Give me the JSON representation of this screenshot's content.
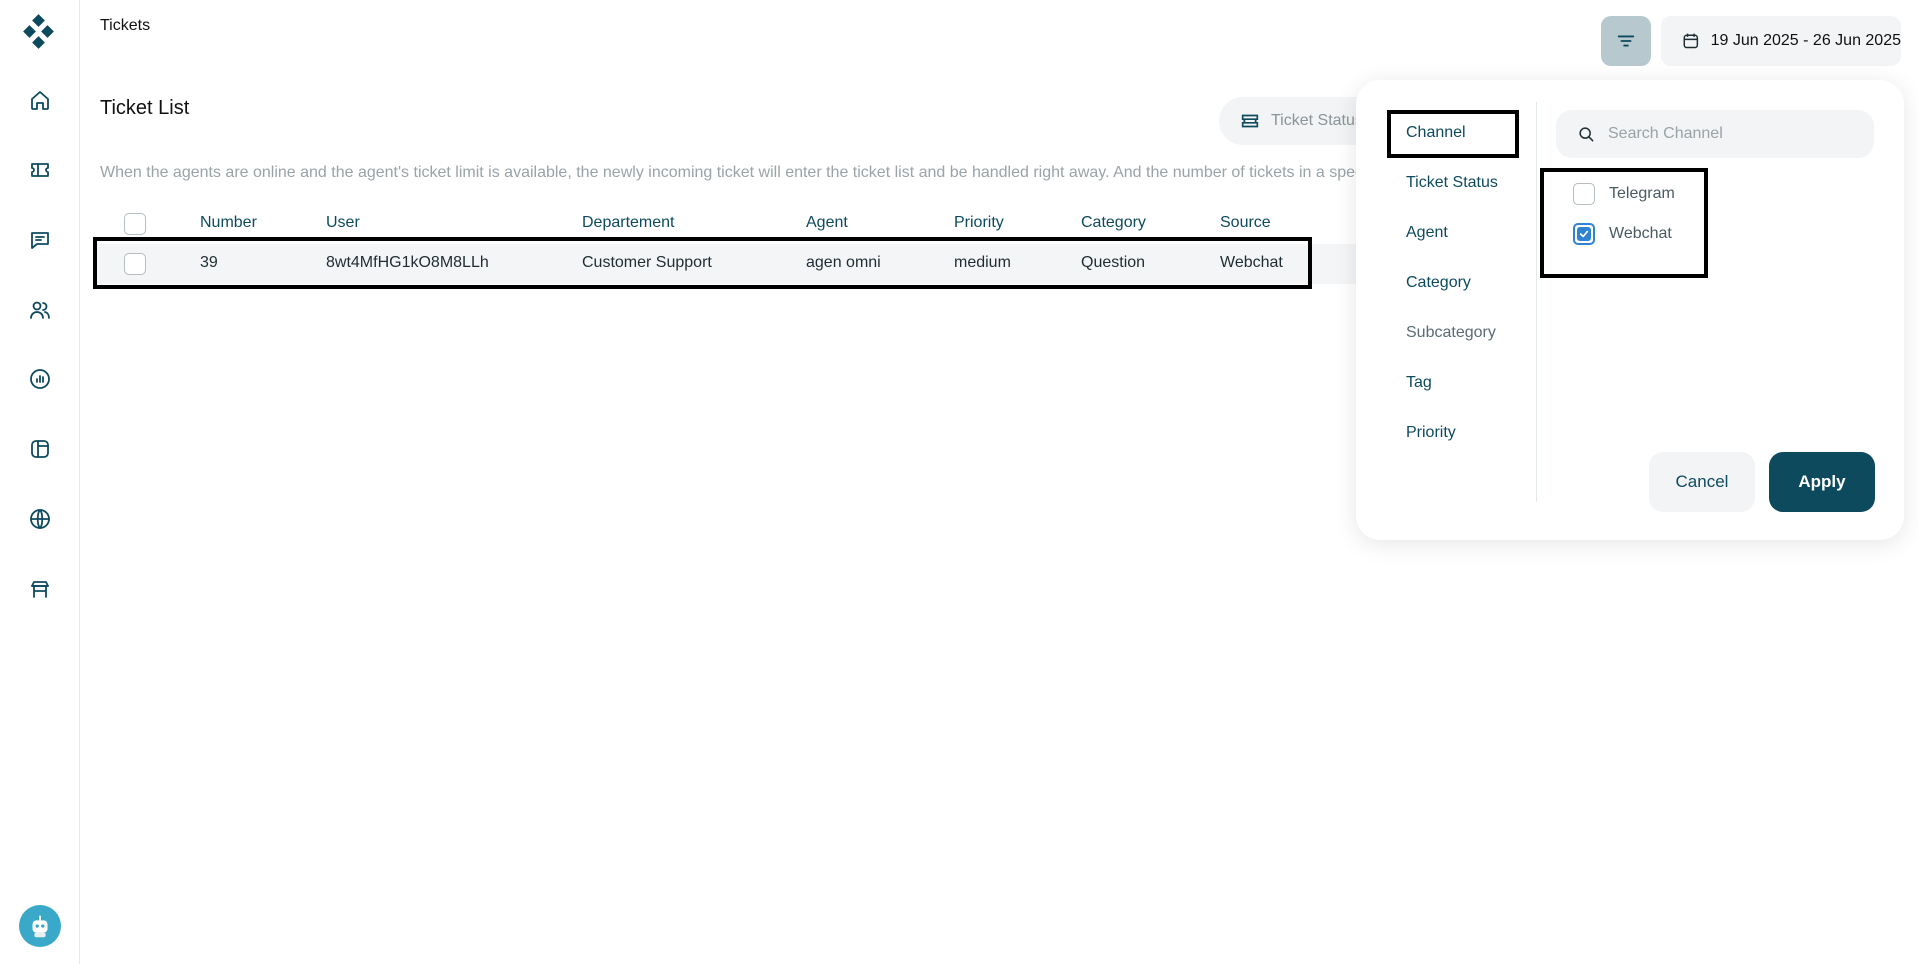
{
  "header": {
    "breadcrumb": "Tickets",
    "date_range": "19 Jun 2025 - 26 Jun 2025"
  },
  "sidebar": {
    "items": [
      {
        "icon": "home-icon"
      },
      {
        "icon": "ticket-icon"
      },
      {
        "icon": "chat-icon"
      },
      {
        "icon": "users-icon"
      },
      {
        "icon": "report-icon"
      },
      {
        "icon": "template-icon"
      },
      {
        "icon": "globe-icon"
      },
      {
        "icon": "store-icon"
      }
    ],
    "avatar_icon": "robot-avatar-icon"
  },
  "main": {
    "title": "Ticket List",
    "ticket_status_button": "Ticket Status",
    "description": "When the agents are online and the agent's ticket limit is available, the newly incoming ticket will enter the ticket list and be handled right away. And the number of tickets in a specific",
    "table": {
      "columns": [
        "Number",
        "User",
        "Departement",
        "Agent",
        "Priority",
        "Category",
        "Source"
      ],
      "rows": [
        [
          "39",
          "8wt4MfHG1kO8M8LLh",
          "Customer Support",
          "agen omni",
          "medium",
          "Question",
          "Webchat"
        ]
      ]
    }
  },
  "filter_panel": {
    "categories": [
      "Channel",
      "Ticket Status",
      "Agent",
      "Category",
      "Subcategory",
      "Tag",
      "Priority"
    ],
    "active_category": "Channel",
    "search_placeholder": "Search Channel",
    "options": [
      {
        "label": "Telegram",
        "checked": false
      },
      {
        "label": "Webchat",
        "checked": true
      }
    ],
    "cancel_label": "Cancel",
    "apply_label": "Apply"
  },
  "colors": {
    "primary": "#0e4a5e",
    "filter_button_active": "#b7c8ce",
    "checkbox_checked": "#2f83d0",
    "row_background": "#f3f5f6"
  }
}
